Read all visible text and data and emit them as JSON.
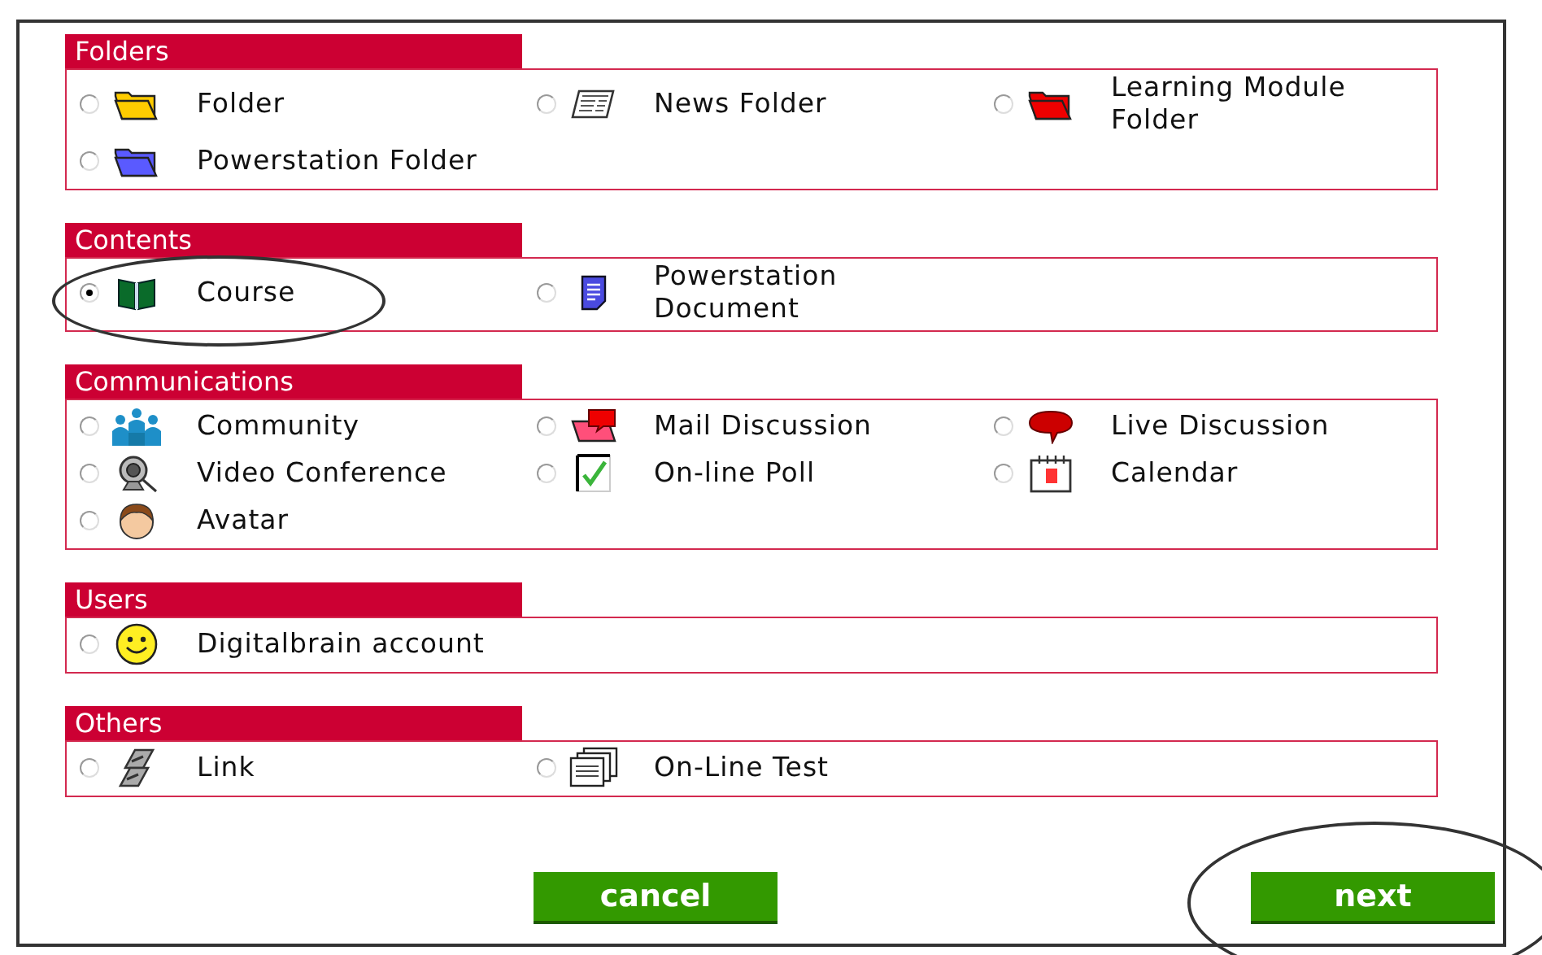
{
  "sections": [
    {
      "title": "Folders",
      "options": [
        {
          "label": "Folder",
          "kind": "folder-yellow",
          "selected": false,
          "circled": false
        },
        {
          "label": "News Folder",
          "kind": "newspaper",
          "selected": false,
          "circled": false
        },
        {
          "label": "Learning Module Folder",
          "kind": "folder-red",
          "selected": false,
          "circled": false
        },
        {
          "label": "Powerstation Folder",
          "kind": "folder-blue",
          "selected": false,
          "circled": false
        }
      ]
    },
    {
      "title": "Contents",
      "options": [
        {
          "label": "Course",
          "kind": "book",
          "selected": true,
          "circled": true
        },
        {
          "label": "Powerstation Document",
          "kind": "document",
          "selected": false,
          "circled": false
        }
      ]
    },
    {
      "title": "Communications",
      "options": [
        {
          "label": "Community",
          "kind": "people",
          "selected": false,
          "circled": false
        },
        {
          "label": "Mail Discussion",
          "kind": "mail-folder",
          "selected": false,
          "circled": false
        },
        {
          "label": "Live Discussion",
          "kind": "speech-bubble",
          "selected": false,
          "circled": false
        },
        {
          "label": "Video Conference",
          "kind": "webcam",
          "selected": false,
          "circled": false
        },
        {
          "label": "On-line Poll",
          "kind": "checkbox",
          "selected": false,
          "circled": false
        },
        {
          "label": "Calendar",
          "kind": "calendar",
          "selected": false,
          "circled": false
        },
        {
          "label": "Avatar",
          "kind": "avatar",
          "selected": false,
          "circled": false
        }
      ]
    },
    {
      "title": "Users",
      "options": [
        {
          "label": "Digitalbrain account",
          "kind": "smiley",
          "selected": false,
          "circled": false
        }
      ]
    },
    {
      "title": "Others",
      "options": [
        {
          "label": "Link",
          "kind": "chain",
          "selected": false,
          "circled": false
        },
        {
          "label": "On-Line Test",
          "kind": "pages",
          "selected": false,
          "circled": false
        }
      ]
    }
  ],
  "buttons": [
    {
      "label": "cancel",
      "circled": false
    },
    {
      "label": "next",
      "circled": true
    }
  ]
}
